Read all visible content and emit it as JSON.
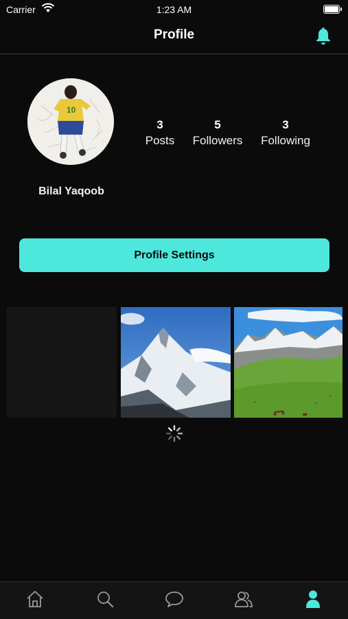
{
  "status_bar": {
    "carrier": "Carrier",
    "time": "1:23 AM"
  },
  "nav": {
    "title": "Profile",
    "notification_icon": "bell-icon"
  },
  "profile": {
    "name": "Bilal Yaqoob",
    "stats": [
      {
        "value": "3",
        "label": "Posts"
      },
      {
        "value": "5",
        "label": "Followers"
      },
      {
        "value": "3",
        "label": "Following"
      }
    ],
    "settings_label": "Profile Settings"
  },
  "posts": [
    {
      "kind": "empty"
    },
    {
      "kind": "image",
      "subject": "snowy mountain peak"
    },
    {
      "kind": "image",
      "subject": "green valley with horses"
    }
  ],
  "tab_bar": {
    "items": [
      {
        "icon": "home-icon",
        "active": false
      },
      {
        "icon": "search-icon",
        "active": false
      },
      {
        "icon": "chat-icon",
        "active": false
      },
      {
        "icon": "people-icon",
        "active": false
      },
      {
        "icon": "profile-icon",
        "active": true
      }
    ]
  },
  "colors": {
    "accent": "#4ee7dc",
    "background": "#0b0b0b",
    "tab_inactive": "#9a9a9a"
  }
}
